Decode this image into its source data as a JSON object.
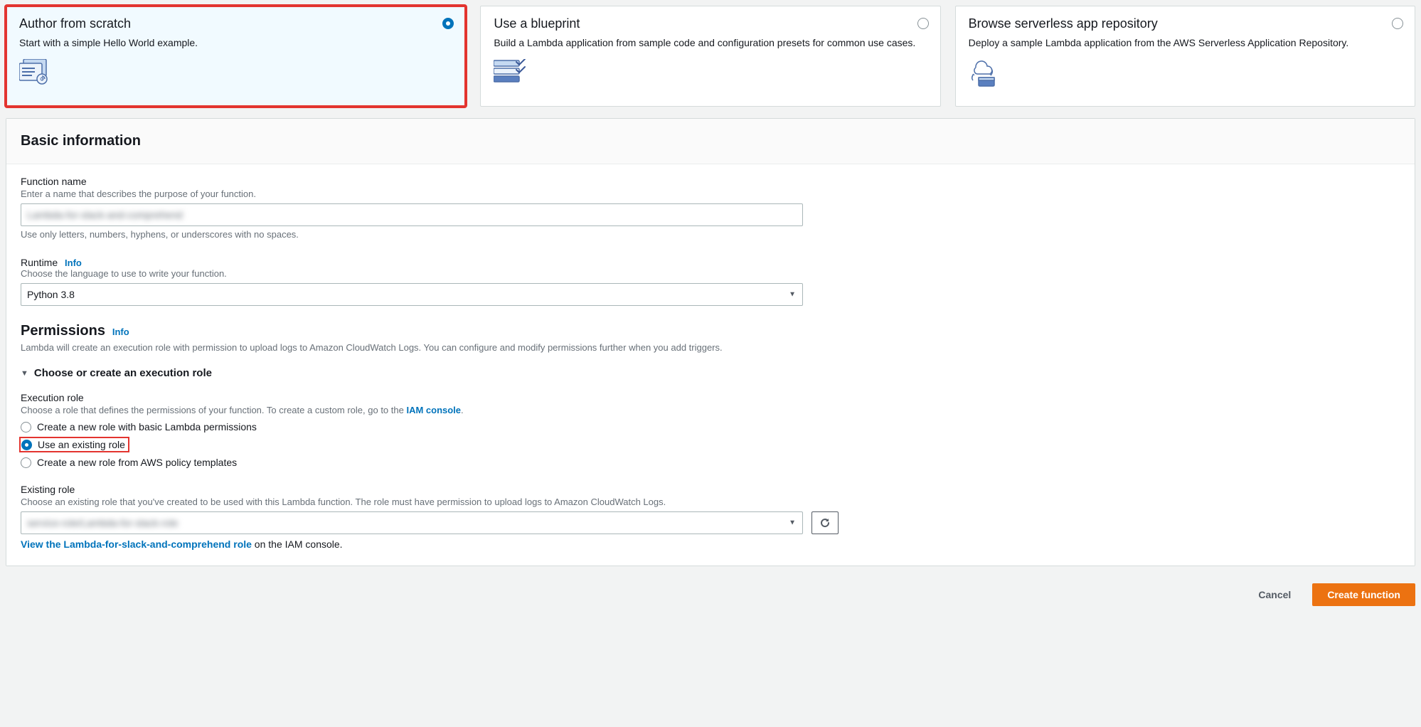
{
  "options": [
    {
      "title": "Author from scratch",
      "desc": "Start with a simple Hello World example.",
      "selected": true
    },
    {
      "title": "Use a blueprint",
      "desc": "Build a Lambda application from sample code and configuration presets for common use cases.",
      "selected": false
    },
    {
      "title": "Browse serverless app repository",
      "desc": "Deploy a sample Lambda application from the AWS Serverless Application Repository.",
      "selected": false
    }
  ],
  "basic": {
    "panel_title": "Basic information",
    "function_name_label": "Function name",
    "function_name_sub": "Enter a name that describes the purpose of your function.",
    "function_name_value": "Lambda-for-slack-and-comprehend",
    "function_name_hint": "Use only letters, numbers, hyphens, or underscores with no spaces.",
    "runtime_label": "Runtime",
    "runtime_info": "Info",
    "runtime_sub": "Choose the language to use to write your function.",
    "runtime_value": "Python 3.8"
  },
  "permissions": {
    "title": "Permissions",
    "info": "Info",
    "sub": "Lambda will create an execution role with permission to upload logs to Amazon CloudWatch Logs. You can configure and modify permissions further when you add triggers.",
    "expander": "Choose or create an execution role",
    "exec_role_label": "Execution role",
    "exec_role_sub_prefix": "Choose a role that defines the permissions of your function. To create a custom role, go to the ",
    "exec_role_iam_link": "IAM console",
    "radios": [
      {
        "label": "Create a new role with basic Lambda permissions",
        "checked": false
      },
      {
        "label": "Use an existing role",
        "checked": true
      },
      {
        "label": "Create a new role from AWS policy templates",
        "checked": false
      }
    ],
    "existing_label": "Existing role",
    "existing_sub": "Choose an existing role that you've created to be used with this Lambda function. The role must have permission to upload logs to Amazon CloudWatch Logs.",
    "existing_value": "service-role/Lambda-for-slack-role",
    "view_role_link": "View the Lambda-for-slack-and-comprehend role",
    "view_role_suffix": " on the IAM console."
  },
  "footer": {
    "cancel": "Cancel",
    "create": "Create function"
  }
}
